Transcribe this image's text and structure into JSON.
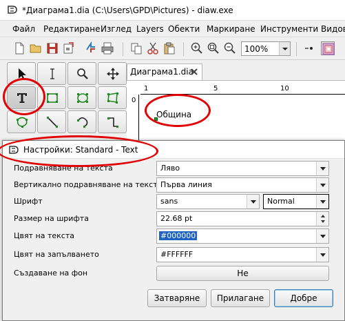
{
  "window": {
    "title": "*Диаграма1.dia (C:\\Users\\GPD\\Pictures) - diaw.exe"
  },
  "menu": [
    "Файл",
    "Редактиране",
    "Изглед",
    "Layers",
    "Обекти",
    "Маркиране",
    "Инструменти",
    "Видове"
  ],
  "toolbar": {
    "zoom": "100%",
    "icons": [
      "new-file-icon",
      "open-file-icon",
      "save-icon",
      "export-icon",
      "print-icon",
      "copy-icon",
      "cut-icon",
      "paste-icon",
      "zoom-in-icon",
      "zoom-fit-icon",
      "zoom-out-icon",
      "snap-grid-icon",
      "grid-icon"
    ]
  },
  "document": {
    "tab_label": "Диаграма1.dia",
    "ruler_h": [
      "1",
      "5",
      "10"
    ],
    "ruler_v": [
      "0"
    ],
    "text_object": "Община"
  },
  "dialog": {
    "title": "Настройки: Standard - Text",
    "rows": [
      {
        "label": "Подравняване на текста",
        "value": "Ляво"
      },
      {
        "label": "Вертикално подравняване на текста",
        "value": "Първа линия"
      },
      {
        "label": "Шрифт",
        "value": "sans",
        "style": "Normal"
      },
      {
        "label": "Размер на шрифта",
        "value": "22.68 pt"
      },
      {
        "label": "Цвят на текста",
        "value": "#000000"
      },
      {
        "label": "Цвят на запълването",
        "value": "#FFFFFF"
      },
      {
        "label": "Създаване на фон",
        "value": "Не"
      }
    ],
    "buttons": {
      "close": "Затваряне",
      "apply": "Прилагане",
      "ok": "Добре"
    }
  },
  "annotation_color": "#e00000"
}
